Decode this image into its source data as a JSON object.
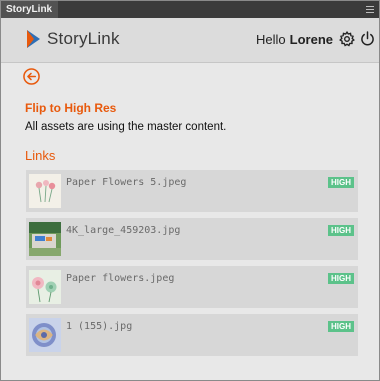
{
  "panel": {
    "tab_label": "StoryLink"
  },
  "header": {
    "brand": "StoryLink",
    "greeting": "Hello",
    "user_name": "Lorene"
  },
  "flip": {
    "title": "Flip to High Res",
    "message": "All assets are using the master content."
  },
  "links": {
    "title": "Links",
    "items": [
      {
        "name": "Paper Flowers 5.jpeg",
        "badge": "HIGH"
      },
      {
        "name": "4K_large_459203.jpg",
        "badge": "HIGH"
      },
      {
        "name": "Paper flowers.jpeg",
        "badge": "HIGH"
      },
      {
        "name": "1 (155).jpg",
        "badge": "HIGH"
      }
    ]
  },
  "colors": {
    "accent": "#e8590c",
    "badge": "#5cc28a",
    "brand_blue": "#2f6fb5"
  }
}
